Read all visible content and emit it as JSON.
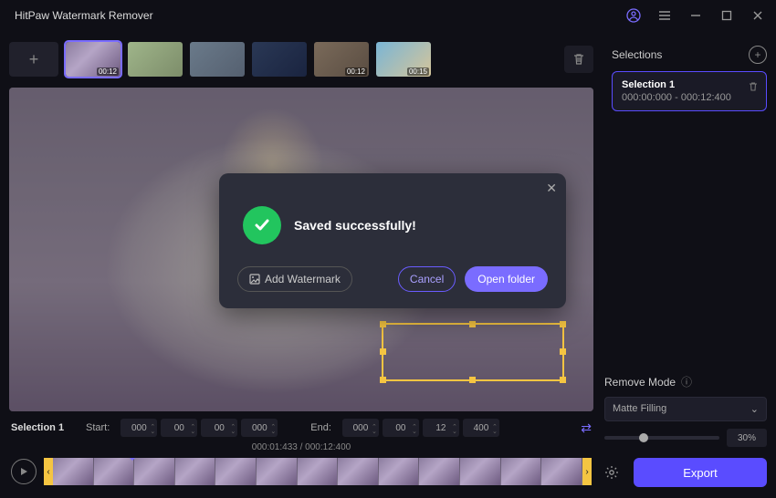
{
  "titlebar": {
    "title": "HitPaw Watermark Remover"
  },
  "thumbs": [
    {
      "dur": "00:12",
      "selected": true
    },
    {
      "dur": ""
    },
    {
      "dur": ""
    },
    {
      "dur": ""
    },
    {
      "dur": "00:12"
    },
    {
      "dur": "00:15"
    }
  ],
  "timecode": {
    "selection_label": "Selection 1",
    "start_label": "Start:",
    "end_label": "End:",
    "start": {
      "h": "000",
      "m": "00",
      "s": "00",
      "ms": "000"
    },
    "end": {
      "h": "000",
      "m": "00",
      "s": "12",
      "ms": "400"
    }
  },
  "timeline": {
    "current": "000:01:433",
    "total": "000:12:400"
  },
  "sidebar": {
    "heading": "Selections",
    "item": {
      "name": "Selection 1",
      "range": "000:00:000 - 000:12:400"
    },
    "remove_mode_label": "Remove Mode",
    "mode_value": "Matte Filling",
    "slider_pct": "30%",
    "export_label": "Export"
  },
  "modal": {
    "message": "Saved successfully!",
    "add_watermark": "Add Watermark",
    "cancel": "Cancel",
    "open_folder": "Open folder"
  }
}
